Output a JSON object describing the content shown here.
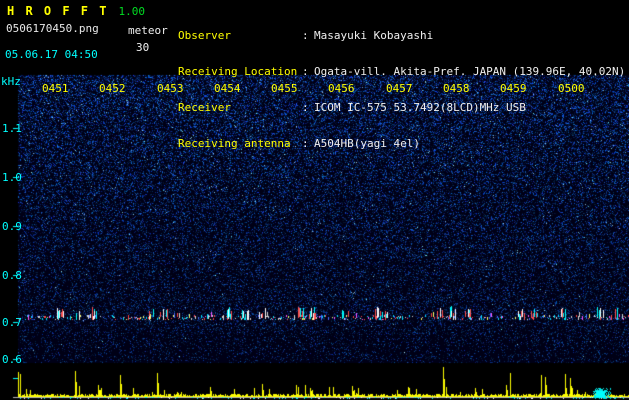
{
  "header": {
    "app_name": "H R O F F T",
    "version": "1.00",
    "filename": "0506170450.png",
    "mode": "meteor",
    "interval": "30",
    "datetime": "05.06.17 04:50",
    "separator": ":",
    "info": [
      {
        "label": "Observer",
        "value": "Masayuki Kobayashi"
      },
      {
        "label": "Receiving Location",
        "value": "Ogata-vill. Akita-Pref. JAPAN (139.96E, 40.02N)"
      },
      {
        "label": "Receiver",
        "value": "ICOM IC-575 53.7492(8LCD)MHz USB"
      },
      {
        "label": "Receiving antenna",
        "value": "A504HB(yagi 4el)"
      }
    ]
  },
  "spectrogram": {
    "y_axis_unit": "kHz",
    "y_ticks": [
      "1.1",
      "1.0",
      "0.9",
      "0.8",
      "0.7",
      "0.6"
    ],
    "time_labels": [
      "0451",
      "0452",
      "0453",
      "0454",
      "0455",
      "0456",
      "0457",
      "0458",
      "0459",
      "0500"
    ],
    "colors": {
      "label_yellow": "#ffff00",
      "axis_cyan": "#00ffff",
      "noise_blue": "#0030c8",
      "echo_red": "#ff4444",
      "power_yellow": "#ffff00",
      "baseline_white": "#b8b8b8"
    }
  }
}
